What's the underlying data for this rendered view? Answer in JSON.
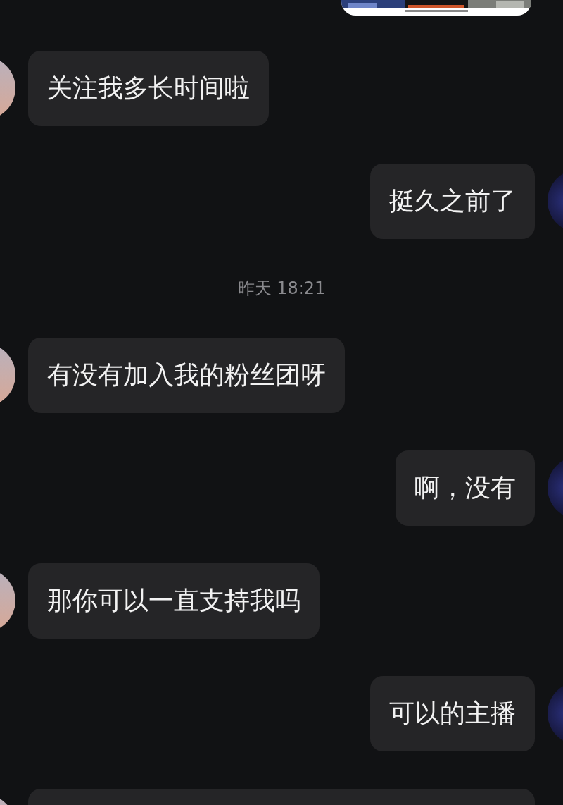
{
  "items": [
    {
      "kind": "incoming",
      "text": "关注我多长时间啦"
    },
    {
      "kind": "outgoing",
      "text": "挺久之前了"
    },
    {
      "kind": "time",
      "text": "昨天 18:21"
    },
    {
      "kind": "incoming",
      "text": "有没有加入我的粉丝团呀"
    },
    {
      "kind": "outgoing",
      "text": "啊，没有"
    },
    {
      "kind": "incoming",
      "text": "那你可以一直支持我吗"
    },
    {
      "kind": "outgoing",
      "text": "可以的主播"
    },
    {
      "kind": "incoming"
    }
  ]
}
